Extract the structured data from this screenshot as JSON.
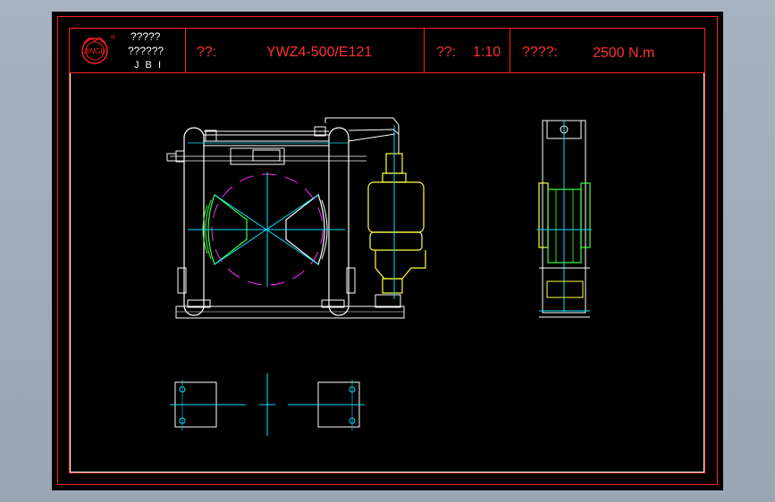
{
  "title_block": {
    "logo_text": "JINGU",
    "registered_mark": "®",
    "company_line1": "?????",
    "company_line2": "??????",
    "company_abbr": "J B I",
    "model_label": "??:",
    "model_value": "YWZ4-500/E121",
    "scale_label": "??:",
    "scale_value": "1:10",
    "torque_label": "????:",
    "torque_value": "2500 N.m"
  },
  "colors": {
    "background": "#000000",
    "frame_red": "#ff2020",
    "border_white": "#ffffff",
    "centerline_cyan": "#00e0ff",
    "thruster_yellow": "#ffff40",
    "brake_green": "#40ff40",
    "drum_magenta": "#ff30ff",
    "workspace": "#a9b4c1"
  }
}
